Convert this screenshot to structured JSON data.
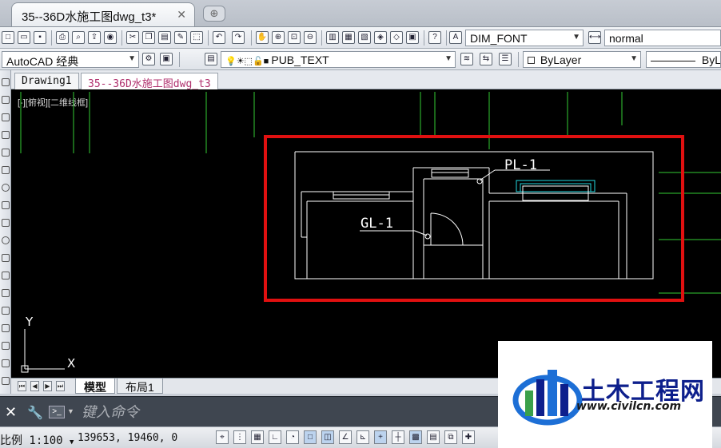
{
  "colors": {
    "canvas_bg": "#000000",
    "wall_lines": "#ffffff",
    "grid_lines": "#33cc33",
    "highlight_box": "#e01010",
    "fixture_cyan": "#22d8e0",
    "watermark_text": "#0d1f8c"
  },
  "file_tab": {
    "title": "35--36D水施工图dwg_t3*",
    "close_icon": "close-icon"
  },
  "toolbar_top": {
    "text_style": "DIM_FONT",
    "dim_style": "normal"
  },
  "toolbar_second": {
    "workspace": "AutoCAD 经典",
    "layer": "PUB_TEXT",
    "color": "ByLayer",
    "linetype": "ByL"
  },
  "doc_tabs": [
    {
      "label": "Drawing1"
    },
    {
      "label": "35--36D水施工图dwg_t3"
    }
  ],
  "viewport_label": "[-][俯视][二维线框]",
  "drawing": {
    "labels": [
      {
        "text": "PL-1"
      },
      {
        "text": "GL-1"
      }
    ]
  },
  "ucs": {
    "y_label": "Y",
    "x_label": "X"
  },
  "layout_tabs": [
    {
      "label": "模型",
      "active": true
    },
    {
      "label": "布局1",
      "active": false
    }
  ],
  "command_line": {
    "placeholder": "键入命令"
  },
  "status_bar": {
    "scale": "比例 1:100",
    "coords": "139653, 19460, 0"
  },
  "watermark": {
    "name": "土木工程网",
    "url": "www.civilcn.com"
  }
}
